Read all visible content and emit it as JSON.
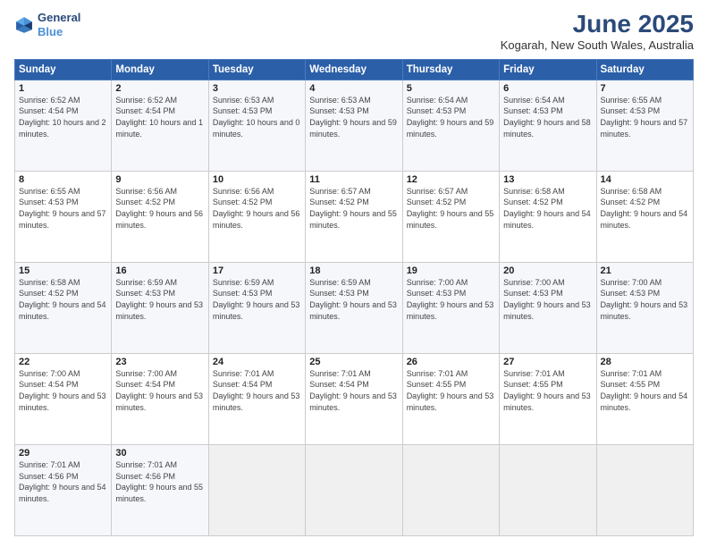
{
  "header": {
    "logo_line1": "General",
    "logo_line2": "Blue",
    "main_title": "June 2025",
    "subtitle": "Kogarah, New South Wales, Australia"
  },
  "weekdays": [
    "Sunday",
    "Monday",
    "Tuesday",
    "Wednesday",
    "Thursday",
    "Friday",
    "Saturday"
  ],
  "weeks": [
    [
      {
        "day": "1",
        "sunrise": "Sunrise: 6:52 AM",
        "sunset": "Sunset: 4:54 PM",
        "daylight": "Daylight: 10 hours and 2 minutes."
      },
      {
        "day": "2",
        "sunrise": "Sunrise: 6:52 AM",
        "sunset": "Sunset: 4:54 PM",
        "daylight": "Daylight: 10 hours and 1 minute."
      },
      {
        "day": "3",
        "sunrise": "Sunrise: 6:53 AM",
        "sunset": "Sunset: 4:53 PM",
        "daylight": "Daylight: 10 hours and 0 minutes."
      },
      {
        "day": "4",
        "sunrise": "Sunrise: 6:53 AM",
        "sunset": "Sunset: 4:53 PM",
        "daylight": "Daylight: 9 hours and 59 minutes."
      },
      {
        "day": "5",
        "sunrise": "Sunrise: 6:54 AM",
        "sunset": "Sunset: 4:53 PM",
        "daylight": "Daylight: 9 hours and 59 minutes."
      },
      {
        "day": "6",
        "sunrise": "Sunrise: 6:54 AM",
        "sunset": "Sunset: 4:53 PM",
        "daylight": "Daylight: 9 hours and 58 minutes."
      },
      {
        "day": "7",
        "sunrise": "Sunrise: 6:55 AM",
        "sunset": "Sunset: 4:53 PM",
        "daylight": "Daylight: 9 hours and 57 minutes."
      }
    ],
    [
      {
        "day": "8",
        "sunrise": "Sunrise: 6:55 AM",
        "sunset": "Sunset: 4:53 PM",
        "daylight": "Daylight: 9 hours and 57 minutes."
      },
      {
        "day": "9",
        "sunrise": "Sunrise: 6:56 AM",
        "sunset": "Sunset: 4:52 PM",
        "daylight": "Daylight: 9 hours and 56 minutes."
      },
      {
        "day": "10",
        "sunrise": "Sunrise: 6:56 AM",
        "sunset": "Sunset: 4:52 PM",
        "daylight": "Daylight: 9 hours and 56 minutes."
      },
      {
        "day": "11",
        "sunrise": "Sunrise: 6:57 AM",
        "sunset": "Sunset: 4:52 PM",
        "daylight": "Daylight: 9 hours and 55 minutes."
      },
      {
        "day": "12",
        "sunrise": "Sunrise: 6:57 AM",
        "sunset": "Sunset: 4:52 PM",
        "daylight": "Daylight: 9 hours and 55 minutes."
      },
      {
        "day": "13",
        "sunrise": "Sunrise: 6:58 AM",
        "sunset": "Sunset: 4:52 PM",
        "daylight": "Daylight: 9 hours and 54 minutes."
      },
      {
        "day": "14",
        "sunrise": "Sunrise: 6:58 AM",
        "sunset": "Sunset: 4:52 PM",
        "daylight": "Daylight: 9 hours and 54 minutes."
      }
    ],
    [
      {
        "day": "15",
        "sunrise": "Sunrise: 6:58 AM",
        "sunset": "Sunset: 4:52 PM",
        "daylight": "Daylight: 9 hours and 54 minutes."
      },
      {
        "day": "16",
        "sunrise": "Sunrise: 6:59 AM",
        "sunset": "Sunset: 4:53 PM",
        "daylight": "Daylight: 9 hours and 53 minutes."
      },
      {
        "day": "17",
        "sunrise": "Sunrise: 6:59 AM",
        "sunset": "Sunset: 4:53 PM",
        "daylight": "Daylight: 9 hours and 53 minutes."
      },
      {
        "day": "18",
        "sunrise": "Sunrise: 6:59 AM",
        "sunset": "Sunset: 4:53 PM",
        "daylight": "Daylight: 9 hours and 53 minutes."
      },
      {
        "day": "19",
        "sunrise": "Sunrise: 7:00 AM",
        "sunset": "Sunset: 4:53 PM",
        "daylight": "Daylight: 9 hours and 53 minutes."
      },
      {
        "day": "20",
        "sunrise": "Sunrise: 7:00 AM",
        "sunset": "Sunset: 4:53 PM",
        "daylight": "Daylight: 9 hours and 53 minutes."
      },
      {
        "day": "21",
        "sunrise": "Sunrise: 7:00 AM",
        "sunset": "Sunset: 4:53 PM",
        "daylight": "Daylight: 9 hours and 53 minutes."
      }
    ],
    [
      {
        "day": "22",
        "sunrise": "Sunrise: 7:00 AM",
        "sunset": "Sunset: 4:54 PM",
        "daylight": "Daylight: 9 hours and 53 minutes."
      },
      {
        "day": "23",
        "sunrise": "Sunrise: 7:00 AM",
        "sunset": "Sunset: 4:54 PM",
        "daylight": "Daylight: 9 hours and 53 minutes."
      },
      {
        "day": "24",
        "sunrise": "Sunrise: 7:01 AM",
        "sunset": "Sunset: 4:54 PM",
        "daylight": "Daylight: 9 hours and 53 minutes."
      },
      {
        "day": "25",
        "sunrise": "Sunrise: 7:01 AM",
        "sunset": "Sunset: 4:54 PM",
        "daylight": "Daylight: 9 hours and 53 minutes."
      },
      {
        "day": "26",
        "sunrise": "Sunrise: 7:01 AM",
        "sunset": "Sunset: 4:55 PM",
        "daylight": "Daylight: 9 hours and 53 minutes."
      },
      {
        "day": "27",
        "sunrise": "Sunrise: 7:01 AM",
        "sunset": "Sunset: 4:55 PM",
        "daylight": "Daylight: 9 hours and 53 minutes."
      },
      {
        "day": "28",
        "sunrise": "Sunrise: 7:01 AM",
        "sunset": "Sunset: 4:55 PM",
        "daylight": "Daylight: 9 hours and 54 minutes."
      }
    ],
    [
      {
        "day": "29",
        "sunrise": "Sunrise: 7:01 AM",
        "sunset": "Sunset: 4:56 PM",
        "daylight": "Daylight: 9 hours and 54 minutes."
      },
      {
        "day": "30",
        "sunrise": "Sunrise: 7:01 AM",
        "sunset": "Sunset: 4:56 PM",
        "daylight": "Daylight: 9 hours and 55 minutes."
      },
      null,
      null,
      null,
      null,
      null
    ]
  ]
}
